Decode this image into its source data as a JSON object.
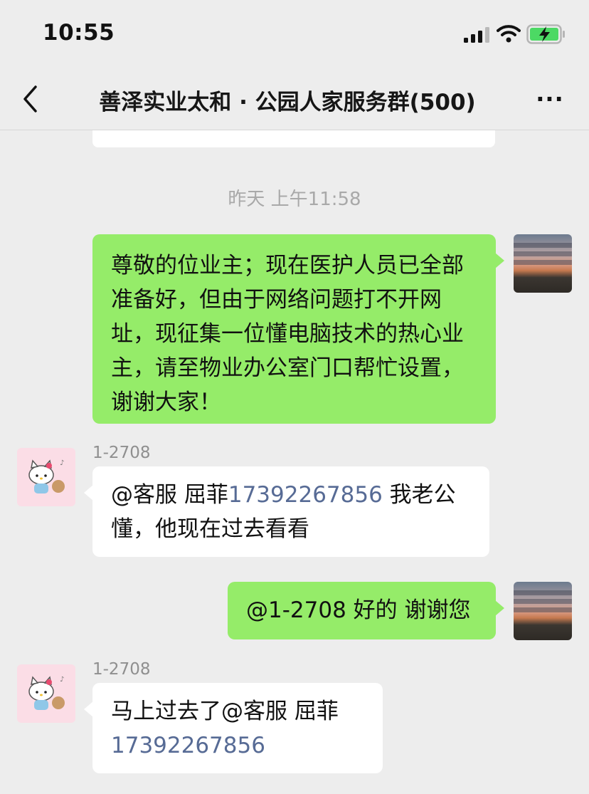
{
  "status_bar": {
    "time": "10:55"
  },
  "nav": {
    "title": "善泽实业太和 · 公园人家服务群(500)",
    "more_label": "···"
  },
  "chat": {
    "timestamp": "昨天 上午11:58",
    "messages": [
      {
        "side": "right",
        "text": "尊敬的位业主；现在医护人员已全部准备好，但由于网络问题打不开网址，现征集一位懂电脑技术的热心业主，请至物业办公室门口帮忙设置，谢谢大家！"
      },
      {
        "side": "left",
        "sender": "1-2708",
        "parts": [
          "@客服 屈菲",
          "17392267856",
          " 我老公懂，他现在过去看看"
        ]
      },
      {
        "side": "right",
        "text": "@1-2708 好的 谢谢您"
      },
      {
        "side": "left",
        "sender": "1-2708",
        "parts": [
          "马上过去了@客服 屈菲",
          "17392267856"
        ]
      }
    ]
  },
  "colors": {
    "background": "#ededed",
    "green_bubble": "#95ec69",
    "link": "#576b95"
  },
  "icons": {
    "back": "chevron-left-icon",
    "more": "more-dots-icon",
    "signal": "signal-icon",
    "wifi": "wifi-icon",
    "battery": "battery-charging-icon"
  }
}
